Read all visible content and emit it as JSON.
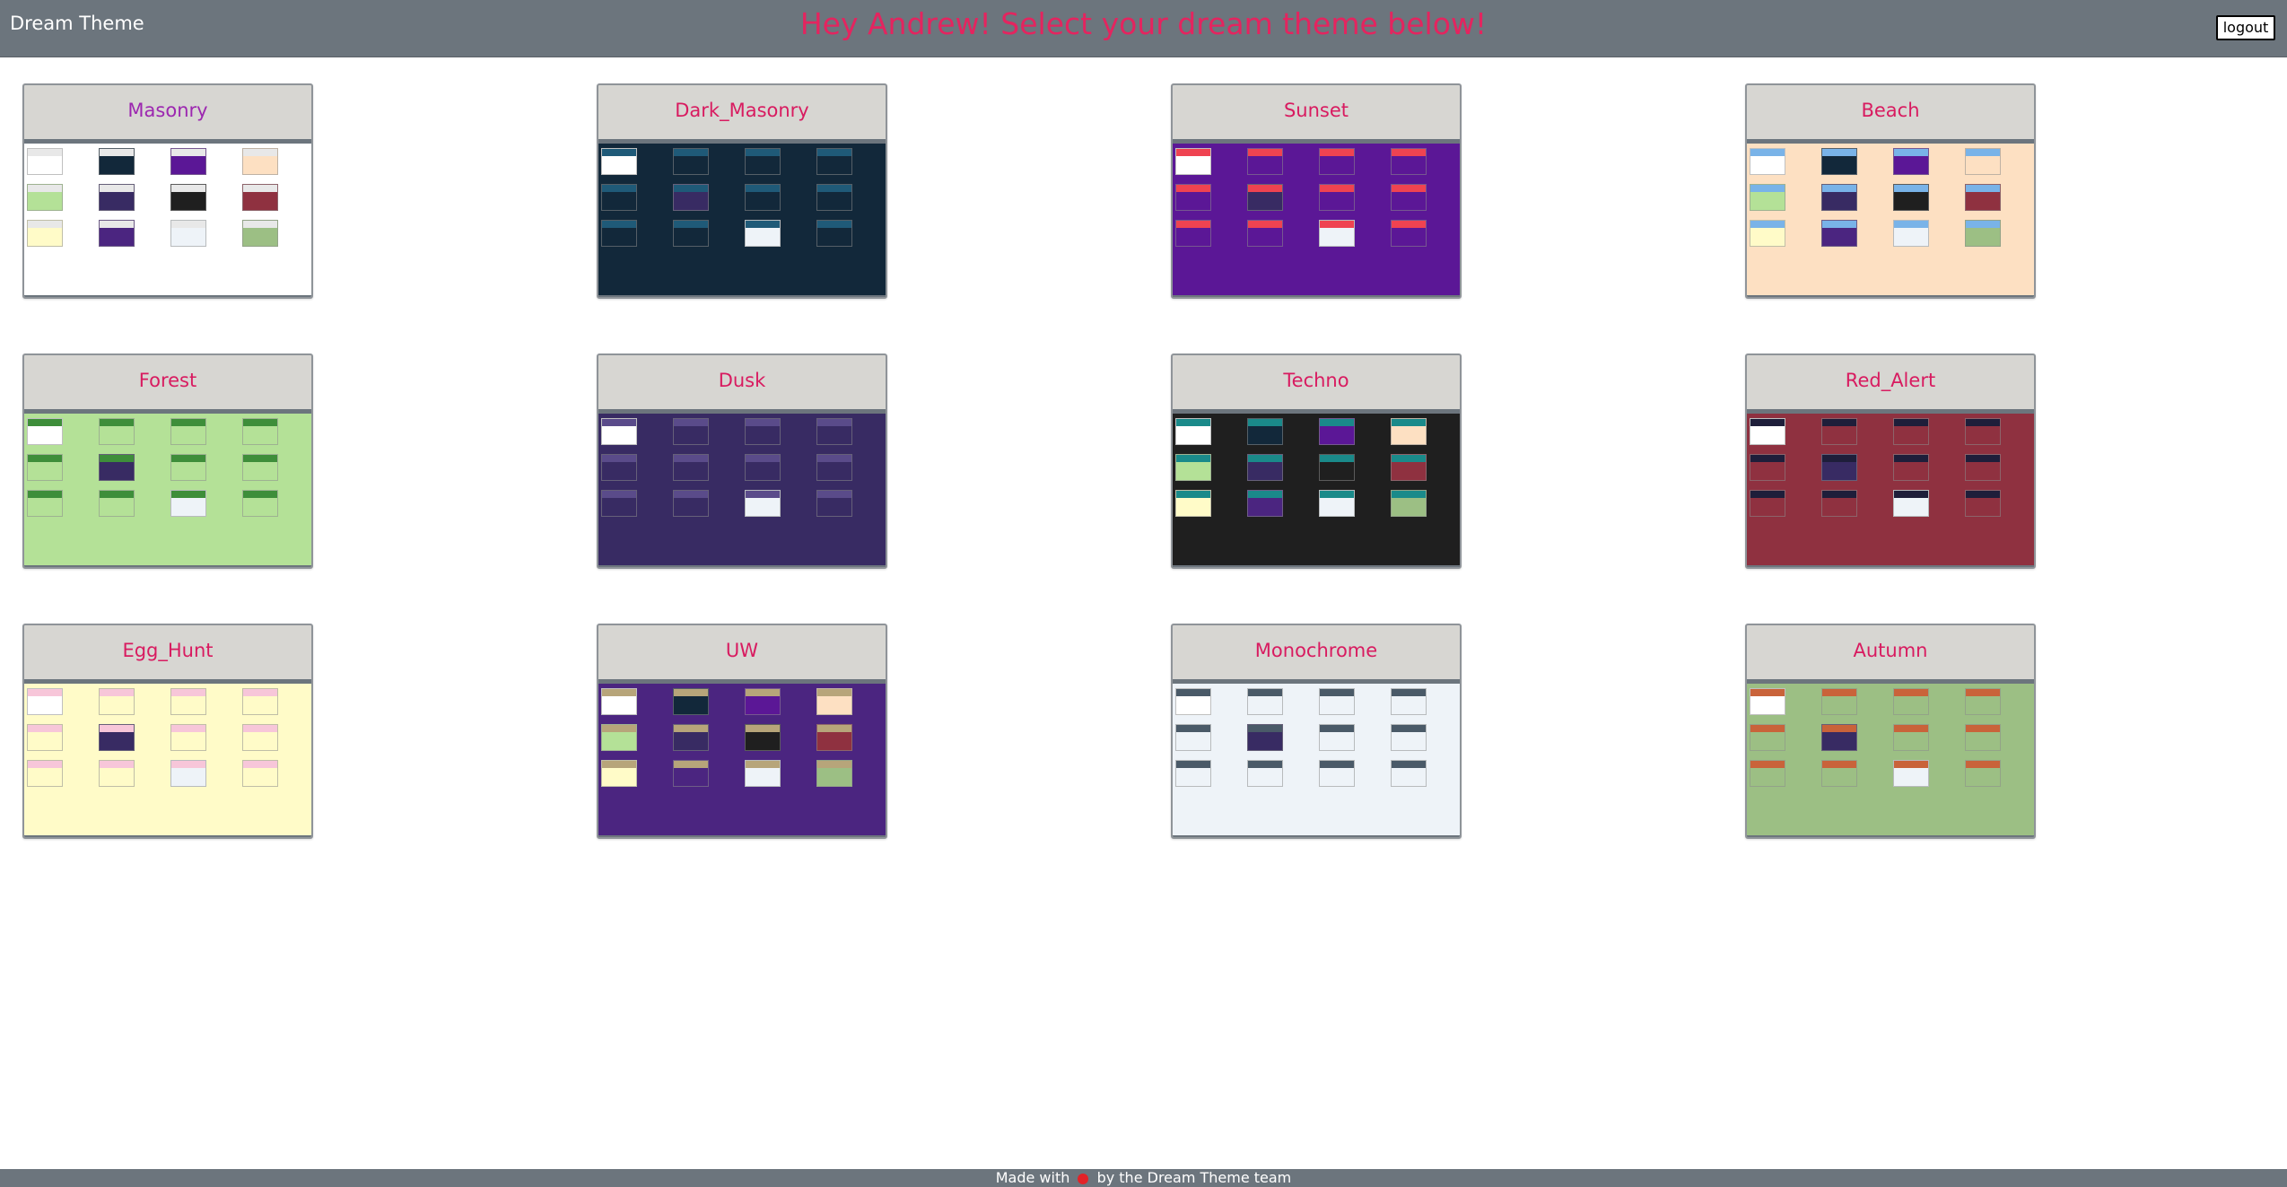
{
  "header": {
    "brand": "Dream Theme",
    "headline": "Hey Andrew! Select your dream theme below!",
    "logout_label": "logout"
  },
  "themes": [
    {
      "name": "Masonry",
      "title_color": "#9c27b0",
      "bg": "#ffffff",
      "tile": "#ffffff",
      "accent": "#e8e8e8"
    },
    {
      "name": "Dark_Masonry",
      "title_color": "#d81b60",
      "bg": "#12283a",
      "tile": "#12283a",
      "accent": "#1f5a78"
    },
    {
      "name": "Sunset",
      "title_color": "#d81b60",
      "bg": "#5b1796",
      "tile": "#5b1796",
      "accent": "#ef4351"
    },
    {
      "name": "Beach",
      "title_color": "#d81b60",
      "bg": "#fde0c2",
      "tile": "#fde0c2",
      "accent": "#79b3e8"
    },
    {
      "name": "Forest",
      "title_color": "#d81b60",
      "bg": "#b4e197",
      "tile": "#b4e197",
      "accent": "#3e8e3a"
    },
    {
      "name": "Dusk",
      "title_color": "#d81b60",
      "bg": "#382b63",
      "tile": "#382b63",
      "accent": "#5a4b8a"
    },
    {
      "name": "Techno",
      "title_color": "#d81b60",
      "bg": "#1f1f1f",
      "tile": "#1f1f1f",
      "accent": "#1a8a8a"
    },
    {
      "name": "Red_Alert",
      "title_color": "#d81b60",
      "bg": "#8f3140",
      "tile": "#8f3140",
      "accent": "#1e1e3a"
    },
    {
      "name": "Egg_Hunt",
      "title_color": "#d81b60",
      "bg": "#fffbc8",
      "tile": "#fffbc8",
      "accent": "#f7c6d9"
    },
    {
      "name": "UW",
      "title_color": "#d81b60",
      "bg": "#4b2580",
      "tile": "#4b2580",
      "accent": "#b7a57a"
    },
    {
      "name": "Monochrome",
      "title_color": "#d81b60",
      "bg": "#eef3f8",
      "tile": "#eef3f8",
      "accent": "#4a5a68"
    },
    {
      "name": "Autumn",
      "title_color": "#d81b60",
      "bg": "#9cbf84",
      "tile": "#9cbf84",
      "accent": "#c9633a"
    }
  ],
  "footer": {
    "prefix": "Made with",
    "suffix": "by the Dream Theme team"
  }
}
